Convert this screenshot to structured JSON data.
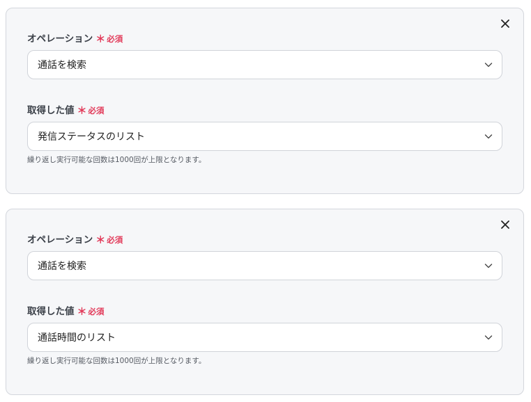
{
  "blocks": [
    {
      "operation_label": "オペレーション",
      "required_text": "必須",
      "operation_value": "通話を検索",
      "value_label": "取得した値",
      "value_value": "発信ステータスのリスト",
      "help_text": "繰り返し実行可能な回数は1000回が上限となります。"
    },
    {
      "operation_label": "オペレーション",
      "required_text": "必須",
      "operation_value": "通話を検索",
      "value_label": "取得した値",
      "value_value": "通話時間のリスト",
      "help_text": "繰り返し実行可能な回数は1000回が上限となります。"
    }
  ],
  "required_mark": "＊",
  "icons": {
    "close": "close-icon",
    "dropdown": "chevron-down-icon"
  },
  "colors": {
    "required": "#e23b5a",
    "card_bg": "#f6f7f9"
  }
}
